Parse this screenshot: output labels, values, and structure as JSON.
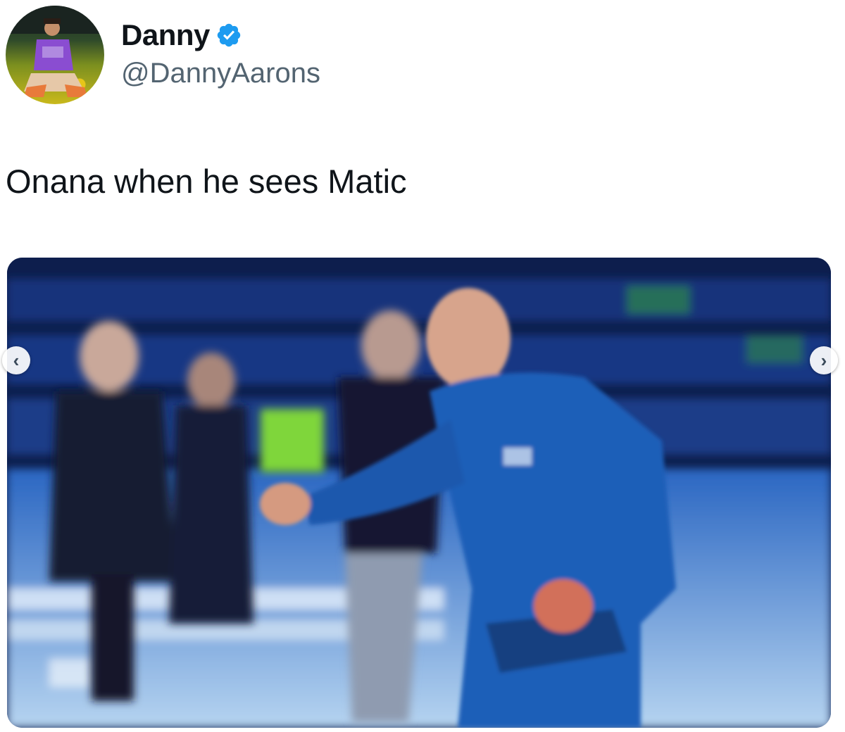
{
  "tweet": {
    "author": {
      "display_name": "Danny",
      "handle": "@DannyAarons",
      "verified": true,
      "avatar_icon": "user-avatar"
    },
    "text": "Onana when he sees Matic",
    "media": {
      "type": "video-still",
      "nav_prev_glyph": "‹",
      "nav_next_glyph": "›"
    }
  },
  "colors": {
    "text_primary": "#0f1419",
    "text_secondary": "#536471",
    "verified_blue": "#1d9bf0"
  }
}
